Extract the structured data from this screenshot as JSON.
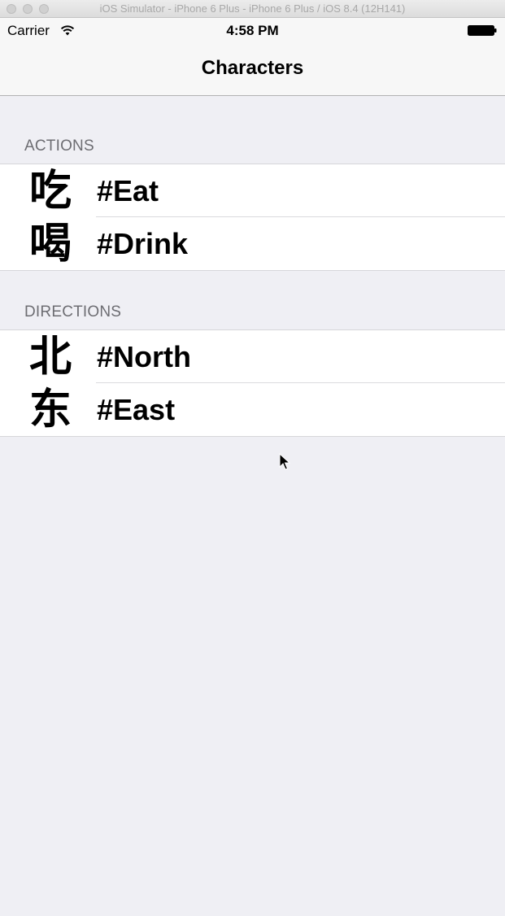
{
  "window": {
    "title": "iOS Simulator - iPhone 6 Plus - iPhone 6 Plus / iOS 8.4 (12H141)"
  },
  "status_bar": {
    "carrier": "Carrier",
    "time": "4:58 PM",
    "wifi_icon": "wifi-icon",
    "battery_icon": "battery-icon"
  },
  "nav_bar": {
    "title": "Characters"
  },
  "sections": [
    {
      "header": "ACTIONS",
      "rows": [
        {
          "glyph": "吃",
          "label": "#Eat"
        },
        {
          "glyph": "喝",
          "label": "#Drink"
        }
      ]
    },
    {
      "header": "DIRECTIONS",
      "rows": [
        {
          "glyph": "北",
          "label": "#North"
        },
        {
          "glyph": "东",
          "label": "#East"
        }
      ]
    }
  ],
  "colors": {
    "background": "#efeff4",
    "cell_background": "#ffffff",
    "section_header_text": "#6d6d72"
  }
}
